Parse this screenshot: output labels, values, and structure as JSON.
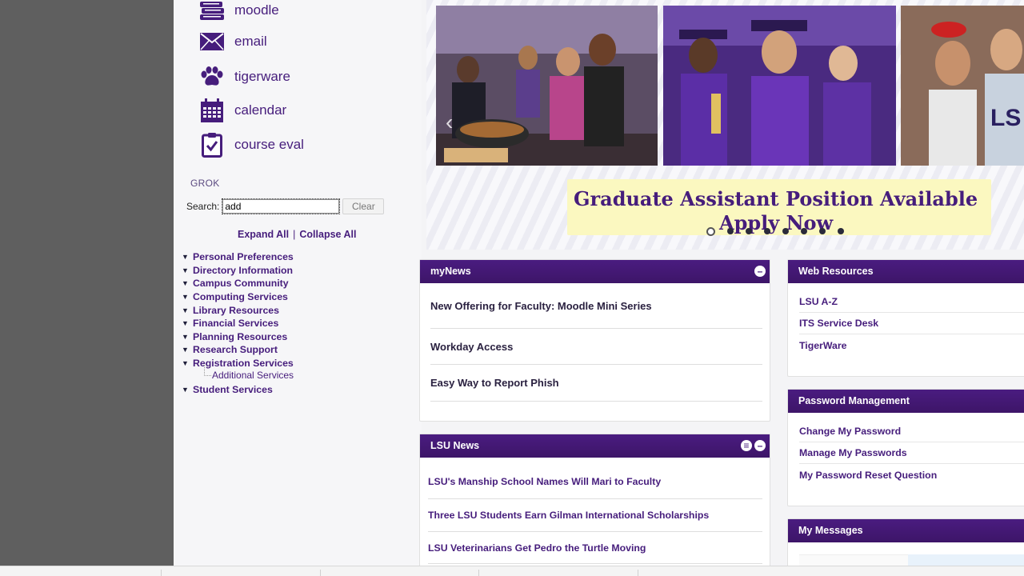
{
  "sidebar": {
    "apps": [
      {
        "label": "moodle",
        "icon": "books-icon"
      },
      {
        "label": "email",
        "icon": "envelope-icon"
      },
      {
        "label": "tigerware",
        "icon": "paw-icon"
      },
      {
        "label": "calendar",
        "icon": "calendar-icon"
      },
      {
        "label": "course eval",
        "icon": "clipboard-check-icon"
      }
    ],
    "grok_label": "GROK",
    "search_label": "Search:",
    "search_value": "add",
    "clear_label": "Clear",
    "expand_all": "Expand All",
    "separator": "|",
    "collapse_all": "Collapse All",
    "tree": [
      "Personal Preferences",
      "Directory Information",
      "Campus Community",
      "Computing Services",
      "Library Resources",
      "Financial Services",
      "Planning Resources",
      "Research Support",
      "Registration Services",
      "Student Services"
    ],
    "tree_sub": "Additional Services"
  },
  "banner": {
    "line1": "Graduate Assistant Position Available",
    "line2": "Apply Now",
    "slide_count": 8,
    "active_slide": 0
  },
  "mynews": {
    "title": "myNews",
    "items": [
      "New Offering for Faculty: Moodle Mini Series",
      "Workday Access",
      "Easy Way to Report Phish"
    ]
  },
  "lsunews": {
    "title": "LSU News",
    "items": [
      "LSU's Manship School Names Will Mari to Faculty",
      "Three LSU Students Earn Gilman International Scholarships",
      "LSU Veterinarians Get Pedro the Turtle Moving"
    ]
  },
  "webres": {
    "title": "Web Resources",
    "items": [
      "LSU A-Z",
      "ITS Service Desk",
      "TigerWare"
    ]
  },
  "password": {
    "title": "Password Management",
    "items": [
      "Change My Password",
      "Manage My Passwords",
      "My Password Reset Question"
    ]
  },
  "messages": {
    "title": "My Messages"
  },
  "colors": {
    "lsu_purple": "#461d7c",
    "banner_yellow": "#fbf8c0"
  }
}
